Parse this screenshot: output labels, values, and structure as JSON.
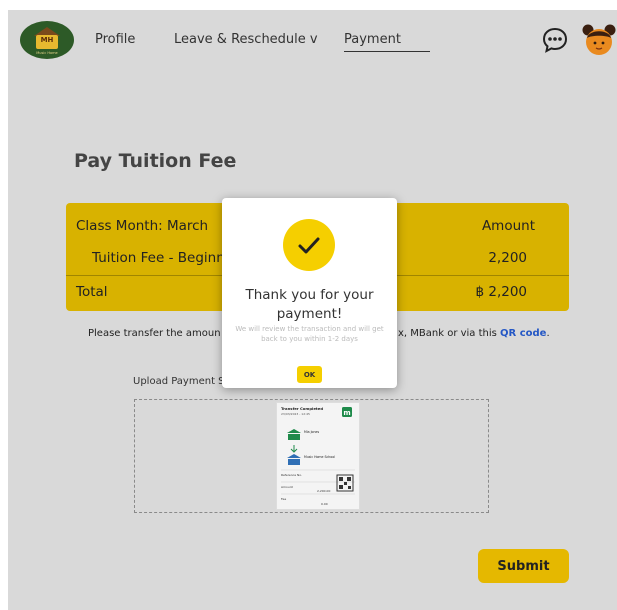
{
  "logo": {
    "text": "MH",
    "subtitle": "Music Home"
  },
  "nav": {
    "profile": "Profile",
    "leave": "Leave & Reschedule v",
    "payment": "Payment"
  },
  "page": {
    "title": "Pay Tuition Fee"
  },
  "fee_table": {
    "header_label": "Class Month: March",
    "header_amount": "Amount",
    "rows": [
      {
        "label": "Tuition Fee - Beginne",
        "value": "2,200"
      }
    ],
    "total_label": "Total",
    "total_value": "฿ 2,200"
  },
  "instructions": {
    "left": "Please transfer the amoun",
    "right": "x, MBank or via this ",
    "qr_link": "QR code",
    "end": "."
  },
  "upload": {
    "label": "Upload Payment S"
  },
  "receipt": {
    "title": "Transfer Completed",
    "date": "23/03/2023 - 12:45",
    "from_name": "Mia Jones",
    "to_name": "Music Home School",
    "reference_label": "Reference No.",
    "amount_label": "Amount",
    "amount_value": "2,200.00",
    "fee_label": "Fee",
    "fee_value": "0.00"
  },
  "submit_button": "Submit",
  "modal": {
    "title": "Thank you for your payment!",
    "subtitle": "We will review the transaction and will get back to you within 1-2 days",
    "ok": "OK"
  },
  "colors": {
    "accent": "#d8b200",
    "button": "#e5b800",
    "link": "#2457c5",
    "logo_bg": "#2d5a27"
  }
}
